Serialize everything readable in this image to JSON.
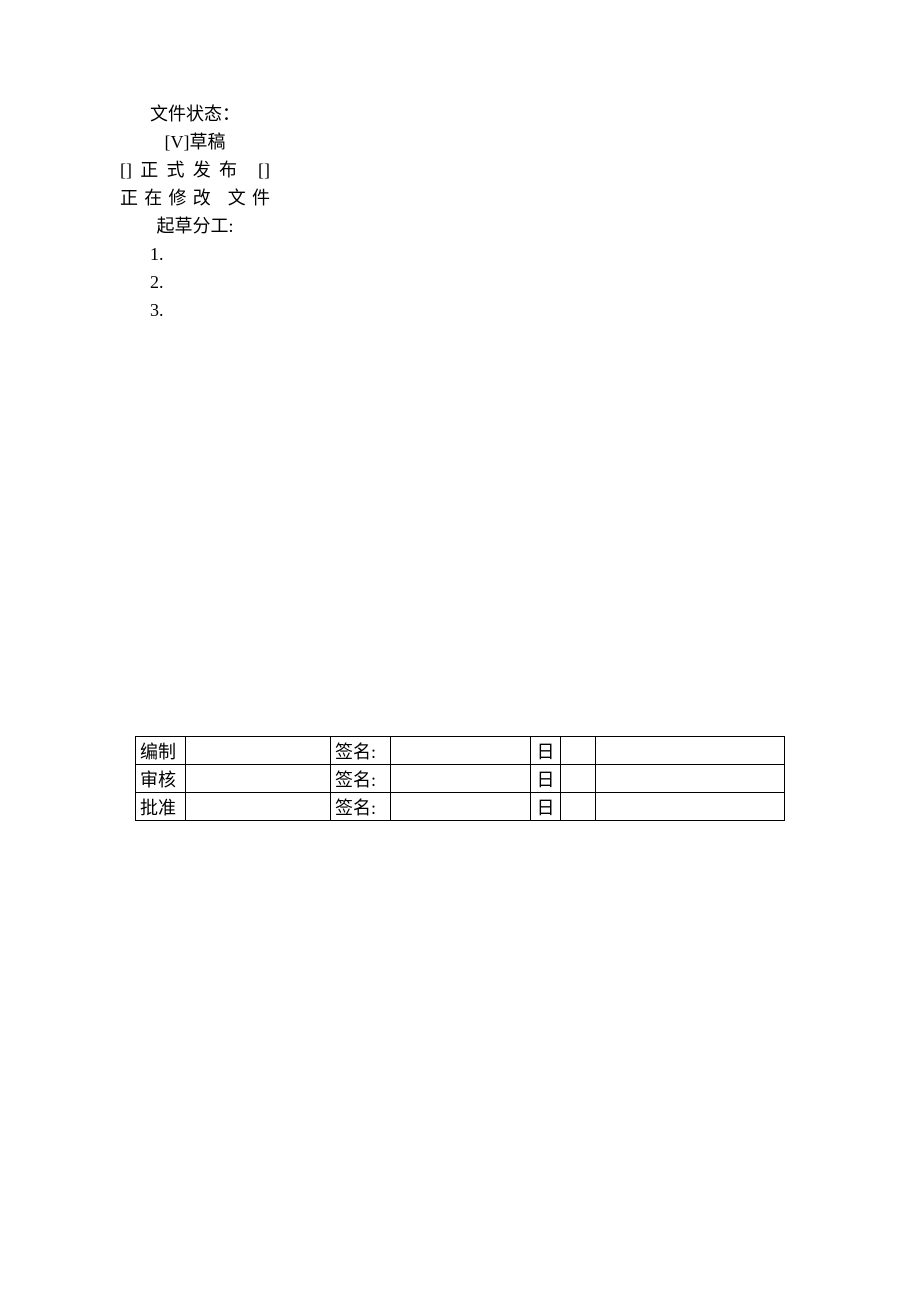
{
  "status": {
    "title": "文件状态：",
    "draft": "[V]草稿",
    "line3": "[]正式发布 []",
    "line4": "正在修改 文件",
    "line5": "起草分工:",
    "items": [
      "1.",
      "2.",
      "3."
    ]
  },
  "table": {
    "rows": [
      {
        "role": "编制",
        "sign_label": "签名:",
        "date_label": "日"
      },
      {
        "role": "审核",
        "sign_label": "签名:",
        "date_label": "日"
      },
      {
        "role": "批准",
        "sign_label": "签名:",
        "date_label": "日"
      }
    ]
  }
}
